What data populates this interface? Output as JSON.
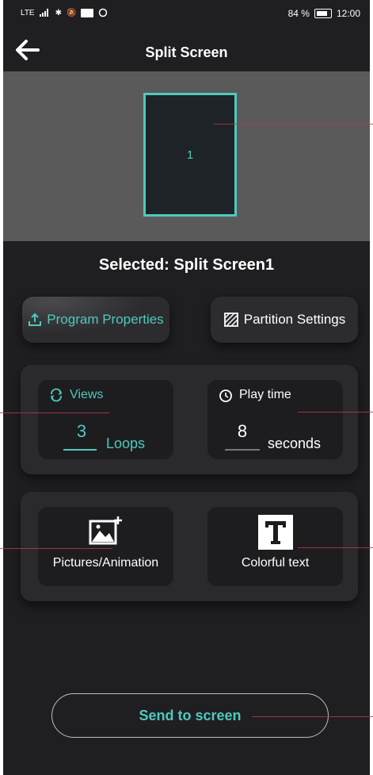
{
  "status_bar": {
    "network": "LTE",
    "battery_percent": "84 %",
    "time": "12:00"
  },
  "header": {
    "title": "Split Screen"
  },
  "preview": {
    "partition_label": "1"
  },
  "selected_text": "Selected: Split Screen1",
  "buttons": {
    "program_properties": "Program Properties",
    "partition_settings": "Partition Settings",
    "send": "Send to screen"
  },
  "views": {
    "label": "Views",
    "value": "3",
    "unit": "Loops"
  },
  "play_time": {
    "label": "Play time",
    "value": "8",
    "unit": "seconds"
  },
  "content_types": {
    "pictures": "Pictures/Animation",
    "text": "Colorful text"
  },
  "colors": {
    "accent": "#4fc9bc",
    "background": "#1f1f22",
    "card": "#2a2a2d",
    "preview_bg": "#5a5a5a"
  },
  "icons": {
    "back": "back-arrow-icon",
    "program": "upload-icon",
    "partition": "grid-hatch-icon",
    "views": "repeat-icon",
    "play_time": "timer-icon",
    "pictures": "image-add-icon",
    "text": "text-t-icon"
  }
}
